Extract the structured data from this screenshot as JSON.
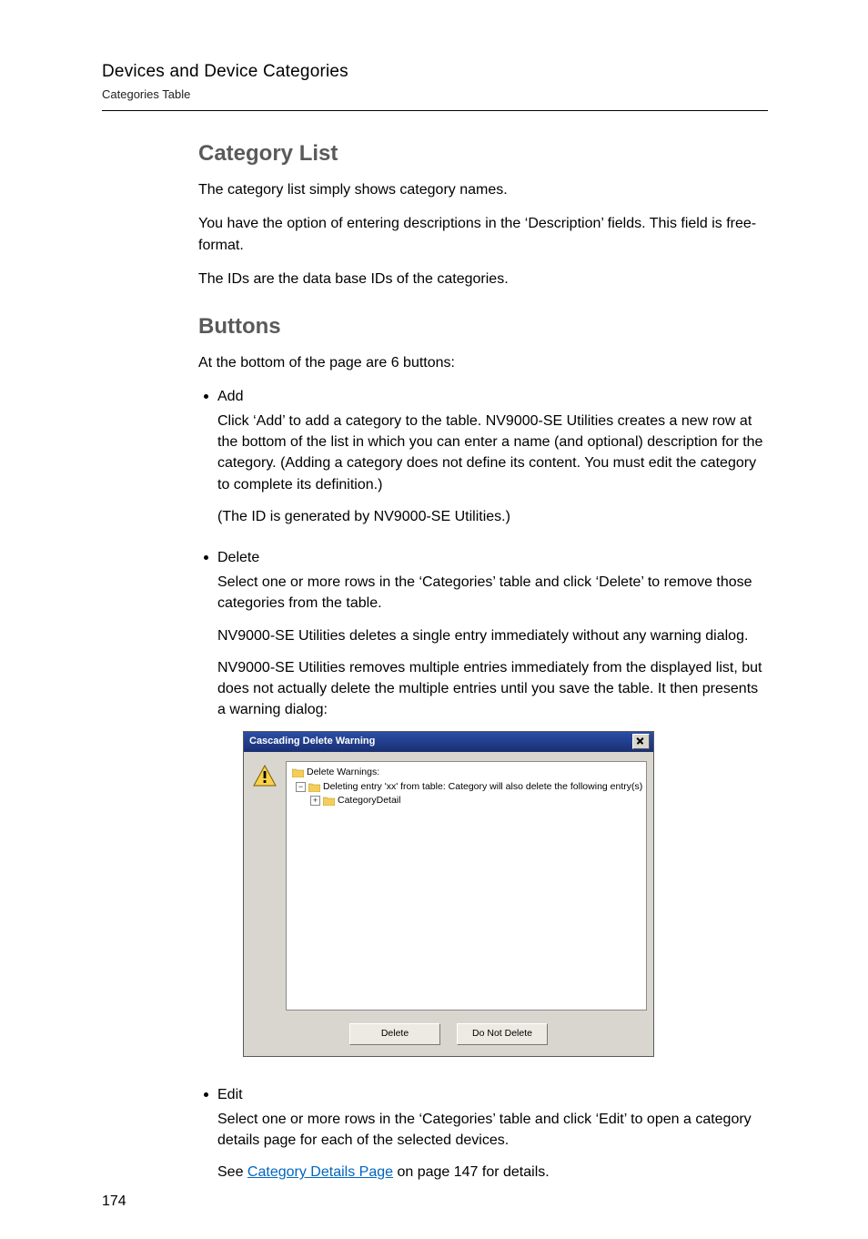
{
  "header": {
    "title": "Devices and Device Categories",
    "subtitle": "Categories Table"
  },
  "sections": {
    "category_list": {
      "heading": "Category List",
      "p1": "The category list simply shows category names.",
      "p2": "You have the option of entering descriptions in the ‘Description’ fields. This field is free-format.",
      "p3": "The IDs are the data base IDs of the categories."
    },
    "buttons": {
      "heading": "Buttons",
      "intro": "At the bottom of the page are 6 buttons:",
      "items": {
        "add": {
          "label": "Add",
          "p1": "Click ‘Add’ to add a category to the table. NV9000-SE Utilities creates a new row at the bottom of the list in which you can enter a name (and optional) description for the category. (Adding a category does not define its content. You must edit the category to complete its definition.)",
          "p2": "(The ID is generated by NV9000-SE Utilities.)"
        },
        "delete": {
          "label": "Delete",
          "p1": "Select one or more rows in the ‘Categories’ table and click ‘Delete’ to remove those categories from the table.",
          "p2": "NV9000-SE Utilities deletes a single entry immediately without any warning dialog.",
          "p3": "NV9000-SE Utilities removes multiple entries immediately from the displayed list, but does not actually delete the multiple entries until you save the table. It then presents a warning dialog:"
        },
        "edit": {
          "label": "Edit",
          "p1": "Select one or more rows in the ‘Categories’ table and click ‘Edit’ to open a category details page for each of the selected devices.",
          "see_pre": "See ",
          "see_link": "Category Details Page",
          "see_post": " on page 147 for details."
        }
      }
    }
  },
  "dialog": {
    "title": "Cascading Delete Warning",
    "tree": {
      "root": "Delete Warnings:",
      "line2": "Deleting entry 'xx' from table: Category will also delete the following entry(s)",
      "line3": "CategoryDetail"
    },
    "buttons": {
      "delete": "Delete",
      "dont": "Do Not Delete"
    }
  },
  "page_number": "174"
}
